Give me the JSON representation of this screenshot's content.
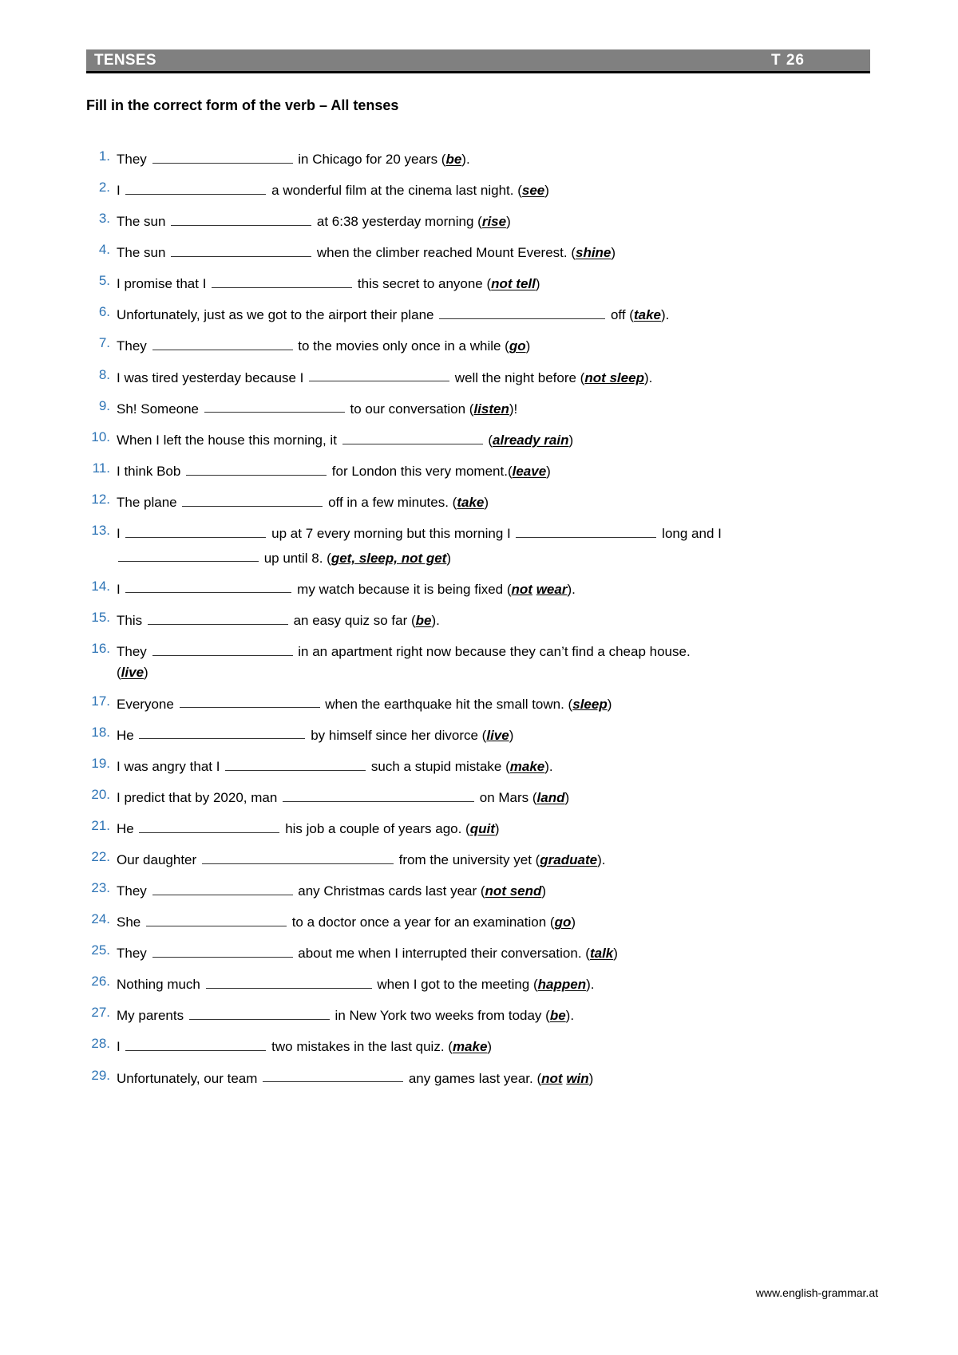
{
  "header": {
    "title": "TENSES",
    "page_code": "T  26",
    "bar_color": "#808080",
    "text_color": "#ffffff"
  },
  "worksheet": {
    "title": "Fill in the correct form of the verb – All tenses",
    "number_color": "#2e74b5"
  },
  "exercises": [
    {
      "number": "1.",
      "pre": "They ",
      "blank": "md",
      "post": " in Chicago for 20 years (",
      "cue": "be",
      "tail": ")."
    },
    {
      "number": "2.",
      "pre": "I ",
      "blank": "md",
      "post": " a wonderful film at the cinema last night. (",
      "cue": "see",
      "tail": ")"
    },
    {
      "number": "3.",
      "pre": "The sun ",
      "blank": "md",
      "post": " at 6:38 yesterday morning (",
      "cue": "rise",
      "tail": ")"
    },
    {
      "number": "4.",
      "pre": "The sun ",
      "blank": "md",
      "post": " when the climber reached Mount Everest. (",
      "cue": "shine",
      "tail": ")"
    },
    {
      "number": "5.",
      "pre": "I promise that I ",
      "blank": "md",
      "post": " this secret to anyone (",
      "cue": "not tell",
      "tail": ")"
    },
    {
      "number": "6.",
      "pre": "Unfortunately, just as we got to the airport their plane ",
      "blank": "lg",
      "post": " off (",
      "cue": "take",
      "tail": ")."
    },
    {
      "number": "7.",
      "pre": "They ",
      "blank": "md",
      "post": " to the movies only once in a while (",
      "cue": "go",
      "tail": ")"
    },
    {
      "number": "8.",
      "pre": "I was tired yesterday because I ",
      "blank": "md",
      "post": " well the night before (",
      "cue": "not sleep",
      "tail": ")."
    },
    {
      "number": "9.",
      "pre": "Sh! Someone ",
      "blank": "md",
      "post": " to our conversation (",
      "cue": "listen",
      "tail": ")!"
    },
    {
      "number": "10.",
      "pre": "When I left the house this morning, it ",
      "blank": "md",
      "post": " (",
      "cue": "already rain",
      "tail": ")"
    },
    {
      "number": "11.",
      "pre": "I think Bob ",
      "blank": "md",
      "post": " for London this very moment.(",
      "cue": "leave",
      "tail": ")"
    },
    {
      "number": "12.",
      "pre": "The plane ",
      "blank": "md",
      "post": " off in a few minutes. (",
      "cue": "take",
      "tail": ")"
    },
    {
      "number": "13.",
      "pre": "I ",
      "blank": "md",
      "post": " up at 7 every morning but this morning I ",
      "blank2": "md",
      "post2": " long and I ",
      "line2_blank": "md",
      "line2_post": " up until 8. (",
      "cue": "get, sleep, not get",
      "tail": ")"
    },
    {
      "number": "14.",
      "pre": "I ",
      "blank": "lg",
      "post": " my watch because it is being fixed (",
      "cue_parts": [
        "not",
        "wear"
      ],
      "tail": ")."
    },
    {
      "number": "15.",
      "pre": "This ",
      "blank": "md",
      "post": " an easy quiz so far (",
      "cue": "be",
      "tail": ")."
    },
    {
      "number": "16.",
      "pre": "They ",
      "blank": "md",
      "post": " in an apartment right now because they can’t find a cheap house.",
      "line2_pre": "(",
      "cue": "live",
      "tail": ")"
    },
    {
      "number": "17.",
      "pre": "Everyone ",
      "blank": "md",
      "post": " when the earthquake hit the small town. (",
      "cue": "sleep",
      "tail": ")"
    },
    {
      "number": "18.",
      "pre": "He ",
      "blank": "lg",
      "post": " by himself since her divorce (",
      "cue": "live",
      "tail": ")"
    },
    {
      "number": "19.",
      "pre": "I was angry that I ",
      "blank": "md",
      "post": " such a stupid mistake (",
      "cue": "make",
      "tail": ")."
    },
    {
      "number": "20.",
      "pre": "I predict that by 2020, man ",
      "blank": "xl",
      "post": " on Mars (",
      "cue": "land",
      "tail": ")"
    },
    {
      "number": "21.",
      "pre": "He ",
      "blank": "md",
      "post": " his job a couple of years ago. (",
      "cue": "quit",
      "tail": ")"
    },
    {
      "number": "22.",
      "pre": "Our daughter ",
      "blank": "xl",
      "post": " from the university yet (",
      "cue": "graduate",
      "tail": ")."
    },
    {
      "number": "23.",
      "pre": "They ",
      "blank": "md",
      "post": " any Christmas cards last year (",
      "cue": "not send",
      "tail": ")"
    },
    {
      "number": "24.",
      "pre": "She ",
      "blank": "md",
      "post": " to a doctor once a year for an examination (",
      "cue": "go",
      "tail": ")"
    },
    {
      "number": "25.",
      "pre": "They ",
      "blank": "md",
      "post": " about me when I interrupted their conversation. (",
      "cue": "talk",
      "tail": ")"
    },
    {
      "number": "26.",
      "pre": "Nothing much ",
      "blank": "lg",
      "post": " when I got to the meeting (",
      "cue": "happen",
      "tail": ")."
    },
    {
      "number": "27.",
      "pre": "My parents ",
      "blank": "md",
      "post": " in New York two weeks from today (",
      "cue": "be",
      "tail": ")."
    },
    {
      "number": "28.",
      "pre": "I ",
      "blank": "md",
      "post": " two mistakes in the last quiz. (",
      "cue": "make",
      "tail": ")"
    },
    {
      "number": "29.",
      "pre": "Unfortunately, our team ",
      "blank": "md",
      "post": " any games last year. (",
      "cue_parts": [
        "not",
        "win"
      ],
      "tail": ")"
    }
  ],
  "footer": {
    "url": "www.english-grammar.at"
  }
}
